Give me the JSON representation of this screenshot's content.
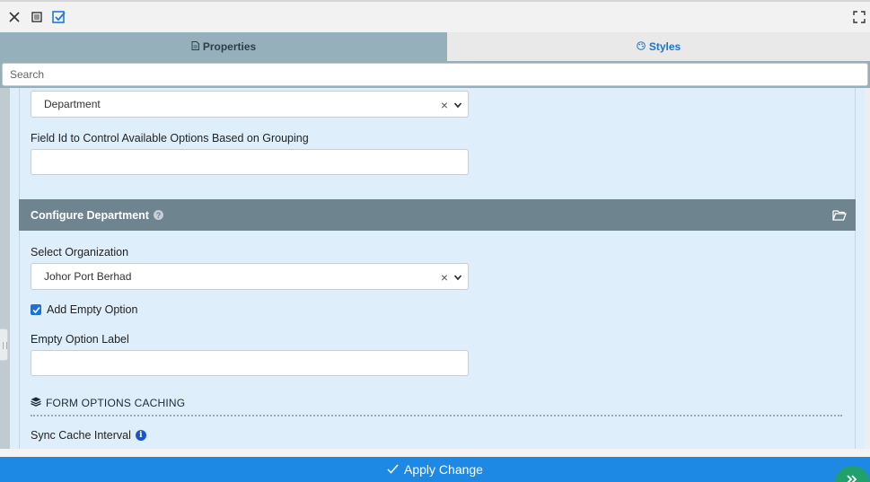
{
  "toolbar": {
    "close_icon": "close-icon",
    "list_icon": "list-icon",
    "check_icon": "checkbox-icon",
    "fullscreen_icon": "fullscreen-icon"
  },
  "tabs": [
    {
      "label": "Properties",
      "icon": "document-icon",
      "active": true
    },
    {
      "label": "Styles",
      "icon": "palette-icon",
      "active": false
    }
  ],
  "search": {
    "placeholder": "Search",
    "value": ""
  },
  "form": {
    "grouping_select_value": "Department",
    "grouping_field_label": "Field Id to Control Available Options Based on Grouping",
    "grouping_field_value": "",
    "section_title": "Configure Department",
    "organization_label": "Select Organization",
    "organization_value": "Johor Port Berhad",
    "add_empty_label": "Add Empty Option",
    "add_empty_checked": true,
    "empty_label_label": "Empty Option Label",
    "empty_label_value": "",
    "cache_heading": "FORM OPTIONS CACHING",
    "sync_label": "Sync Cache Interval"
  },
  "apply_button": {
    "label": "Apply Change"
  },
  "colors": {
    "accent": "#1e88e5",
    "section_bar": "#6e848e",
    "tab_active": "#96b0bb",
    "panel": "#dfeefb",
    "fab": "#22a06b"
  }
}
